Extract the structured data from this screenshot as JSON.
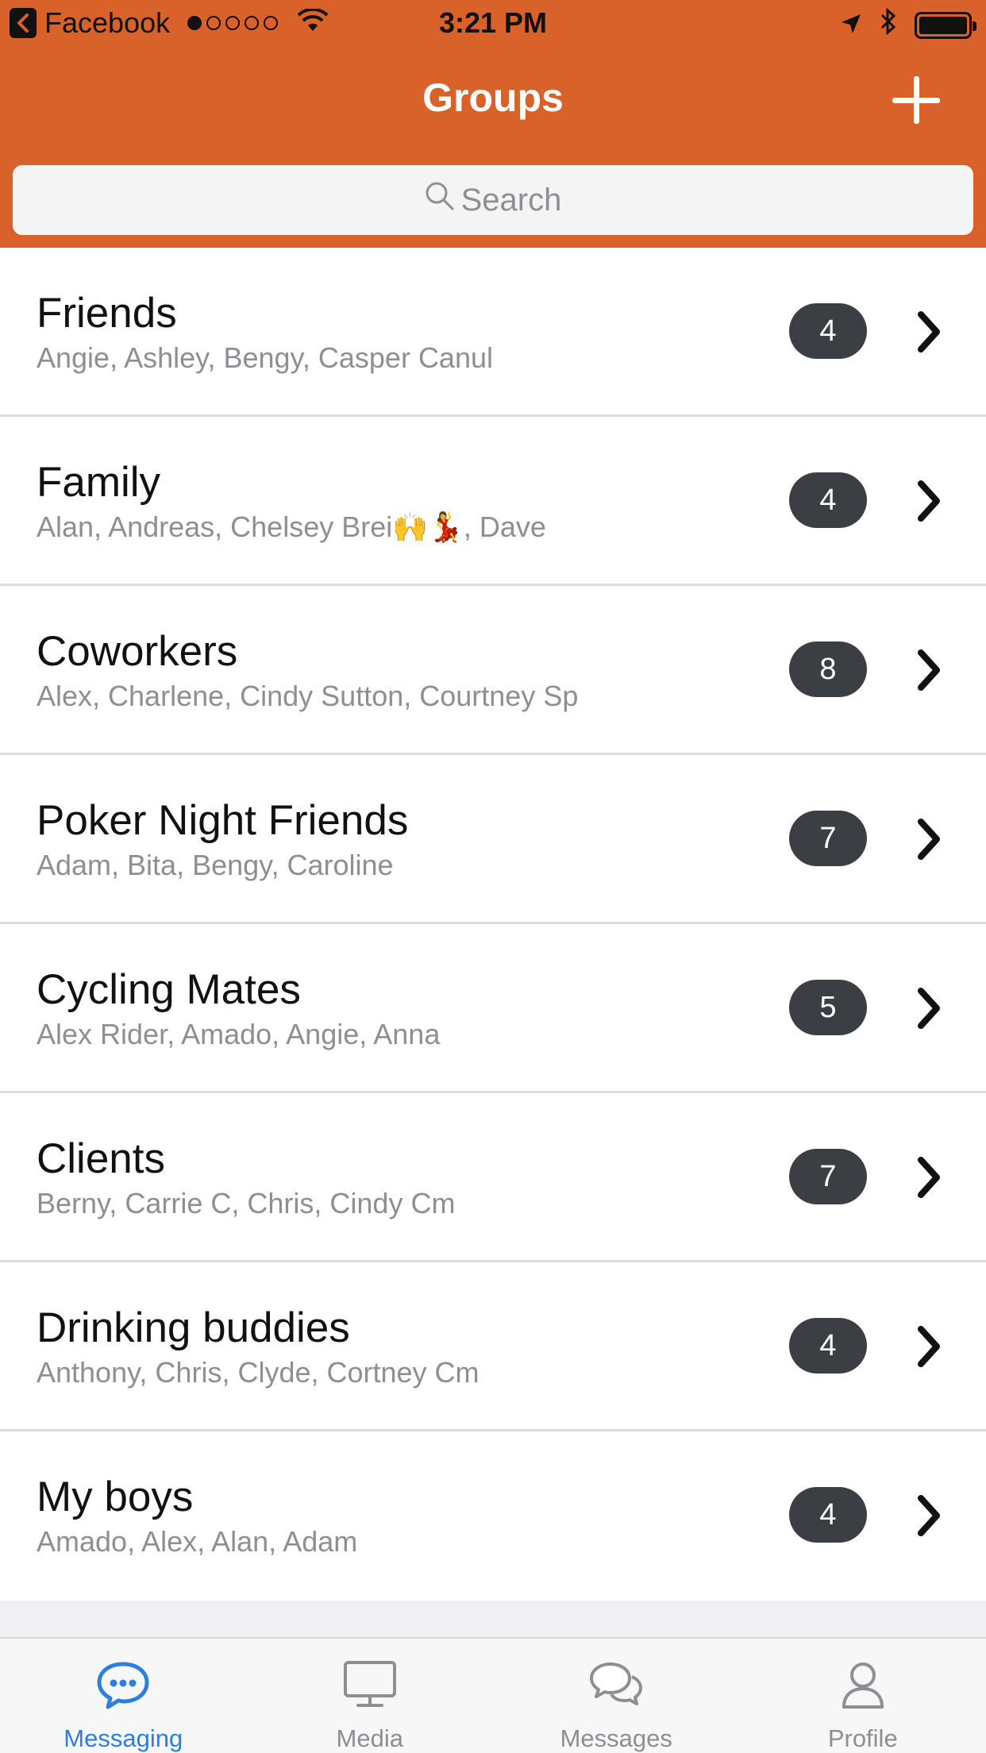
{
  "status_bar": {
    "back_app": "Facebook",
    "signal_dots": 5,
    "signal_filled": 1,
    "time": "3:21 PM",
    "icons": [
      "back-arrow-icon",
      "wifi-icon",
      "location-arrow-icon",
      "bluetooth-icon",
      "battery-icon"
    ]
  },
  "navbar": {
    "title": "Groups",
    "add_icon": "plus-icon"
  },
  "search": {
    "placeholder": "Search",
    "icon": "search-icon"
  },
  "groups": [
    {
      "name": "Friends",
      "members": "Angie, Ashley, Bengy, Casper Canul",
      "count": "4"
    },
    {
      "name": "Family",
      "members": "Alan, Andreas, Chelsey Brei🙌💃, Dave",
      "count": "4"
    },
    {
      "name": "Coworkers",
      "members": "Alex, Charlene, Cindy Sutton, Courtney Sp",
      "count": "8"
    },
    {
      "name": "Poker Night Friends",
      "members": "Adam, Bita, Bengy, Caroline",
      "count": "7"
    },
    {
      "name": "Cycling Mates",
      "members": "Alex Rider, Amado, Angie, Anna",
      "count": "5"
    },
    {
      "name": "Clients",
      "members": "Berny, Carrie C, Chris, Cindy Cm",
      "count": "7"
    },
    {
      "name": "Drinking buddies",
      "members": "Anthony, Chris, Clyde, Cortney Cm",
      "count": "4"
    },
    {
      "name": "My boys",
      "members": "Amado, Alex, Alan, Adam",
      "count": "4"
    }
  ],
  "tabbar": {
    "tabs": [
      {
        "label": "Messaging",
        "icon": "chat-bubble-icon",
        "active": true
      },
      {
        "label": "Media",
        "icon": "monitor-icon",
        "active": false
      },
      {
        "label": "Messages",
        "icon": "messages-bubbles-icon",
        "active": false
      },
      {
        "label": "Profile",
        "icon": "person-icon",
        "active": false
      }
    ]
  },
  "colors": {
    "accent": "#d9612a",
    "badge": "#3b3e42",
    "active_tab": "#2b7fe0",
    "inactive_tab": "#8e8e93"
  }
}
